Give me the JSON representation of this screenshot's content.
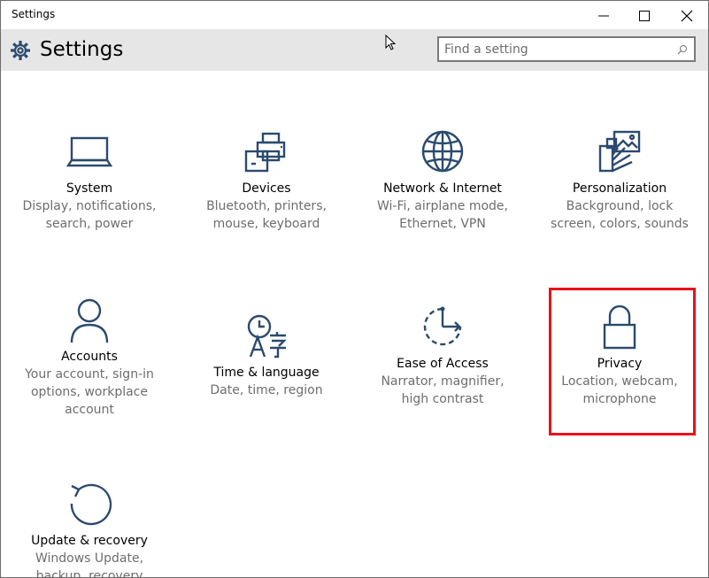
{
  "window": {
    "title": "Settings",
    "controls": [
      "minimize",
      "maximize",
      "close"
    ]
  },
  "header": {
    "icon": "gear-icon",
    "title": "Settings",
    "search_placeholder": "Find a setting"
  },
  "tiles": [
    {
      "icon": "laptop-icon",
      "name": "System",
      "desc": [
        "Display, notifications,",
        "search, power"
      ]
    },
    {
      "icon": "devices-icon",
      "name": "Devices",
      "desc": [
        "Bluetooth, printers,",
        "mouse, keyboard"
      ]
    },
    {
      "icon": "globe-icon",
      "name": "Network & Internet",
      "desc": [
        "Wi-Fi, airplane mode,",
        "Ethernet, VPN"
      ]
    },
    {
      "icon": "personalization-icon",
      "name": "Personalization",
      "desc": [
        "Background, lock",
        "screen, colors, sounds"
      ]
    },
    {
      "icon": "person-icon",
      "name": "Accounts",
      "desc": [
        "Your account, sign-in",
        "options, workplace",
        "account"
      ]
    },
    {
      "icon": "time-language-icon",
      "name": "Time & language",
      "desc": [
        "Date, time, region"
      ]
    },
    {
      "icon": "ease-of-access-icon",
      "name": "Ease of Access",
      "desc": [
        "Narrator, magnifier,",
        "high contrast"
      ]
    },
    {
      "icon": "lock-icon",
      "name": "Privacy",
      "desc": [
        "Location, webcam,",
        "microphone"
      ]
    },
    {
      "icon": "update-recovery-icon",
      "name": "Update & recovery",
      "desc": [
        "Windows Update,",
        "backup, recovery"
      ]
    }
  ],
  "highlight": {
    "target": "Privacy",
    "color": "#e8101a"
  },
  "colors": {
    "icon": "#2b4a6f",
    "header_bg": "#e6e6e6",
    "desc_text": "#6d6d6d"
  }
}
